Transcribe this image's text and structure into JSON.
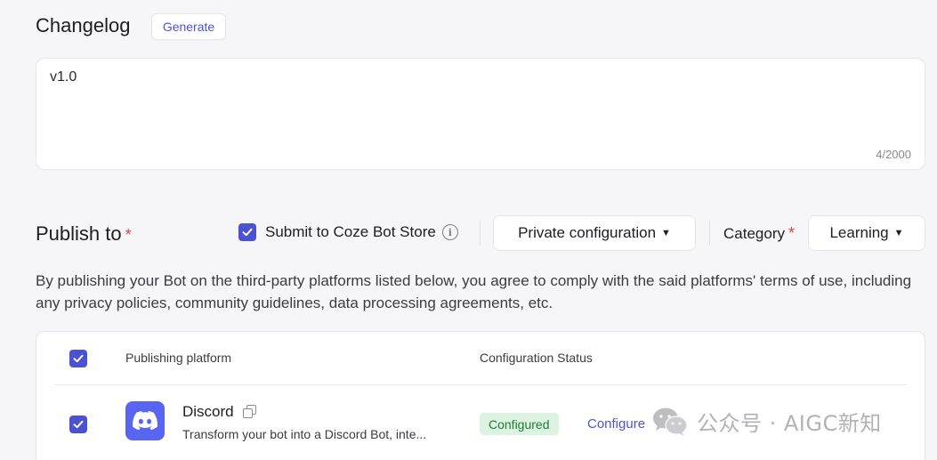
{
  "changelog": {
    "title": "Changelog",
    "generate_label": "Generate",
    "value": "v1.0",
    "counter": "4/2000"
  },
  "publish": {
    "title": "Publish to",
    "required_mark": "*",
    "submit_store_label": "Submit to Coze Bot Store",
    "submit_store_checked": true,
    "private_config_label": "Private configuration",
    "category_label": "Category",
    "category_value": "Learning",
    "disclaimer": "By publishing your Bot on the third-party platforms listed below, you agree to comply with the said platforms' terms of use, including any privacy policies, community guidelines, data processing agreements, etc."
  },
  "table": {
    "headers": [
      "Publishing platform",
      "Configuration Status"
    ],
    "rows": [
      {
        "name": "Discord",
        "description": "Transform your bot into a Discord Bot, inte...",
        "status": "Configured",
        "action": "Configure",
        "icon": "discord-icon",
        "checked": true
      }
    ]
  },
  "watermark": {
    "text": "公众号 · AIGC新知",
    "icon": "wechat-icon"
  },
  "colors": {
    "accent": "#4b51d3",
    "link": "#4c54d6",
    "required": "#e5413f",
    "discord": "#5865f2",
    "status_bg": "#ddf3e2",
    "status_text": "#1e7a34"
  }
}
